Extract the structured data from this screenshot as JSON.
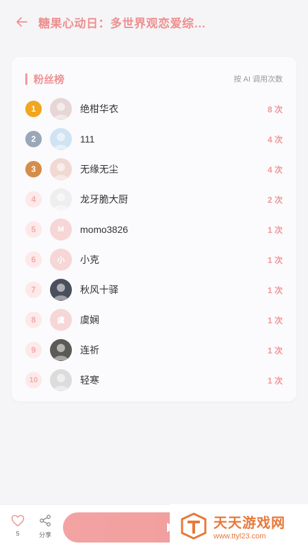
{
  "header": {
    "title": "糖果心动日：多世界观恋爱综…",
    "back_icon": "arrow-left-icon"
  },
  "card": {
    "title": "粉丝榜",
    "subtitle": "按 AI 调用次数"
  },
  "fans": [
    {
      "rank": "1",
      "name": "绝柑华衣",
      "count": "8 次",
      "avatar_color": "#e6d6d6"
    },
    {
      "rank": "2",
      "name": "111",
      "count": "4 次",
      "avatar_color": "#cfe3f3"
    },
    {
      "rank": "3",
      "name": "无缘无尘",
      "count": "4 次",
      "avatar_color": "#f0d8d3"
    },
    {
      "rank": "4",
      "name": "龙牙脆大厨",
      "count": "2 次",
      "avatar_color": "#eeeeee"
    },
    {
      "rank": "5",
      "name": "momo3826",
      "count": "1 次",
      "avatar_letter": "M",
      "avatar_color": "#f6d6d6"
    },
    {
      "rank": "6",
      "name": "小克",
      "count": "1 次",
      "avatar_letter": "小",
      "avatar_color": "#f6d6d6"
    },
    {
      "rank": "7",
      "name": "秋风十驿",
      "count": "1 次",
      "avatar_color": "#4a4f5c"
    },
    {
      "rank": "8",
      "name": "虞娴",
      "count": "1 次",
      "avatar_letter": "虞",
      "avatar_color": "#f6d6d6"
    },
    {
      "rank": "9",
      "name": "连祈",
      "count": "1 次",
      "avatar_color": "#5c5a56"
    },
    {
      "rank": "10",
      "name": "轻寒",
      "count": "1 次",
      "avatar_color": "#dcdcdc"
    }
  ],
  "bottom": {
    "like_count": "5",
    "share_label": "分享"
  },
  "watermark": {
    "name": "天天游戏网",
    "url": "www.ttyl23.com"
  },
  "colors": {
    "accent": "#ee8f8f",
    "gold": "#f0a61e",
    "silver": "#9aa7b8",
    "bronze": "#d58d4a"
  }
}
